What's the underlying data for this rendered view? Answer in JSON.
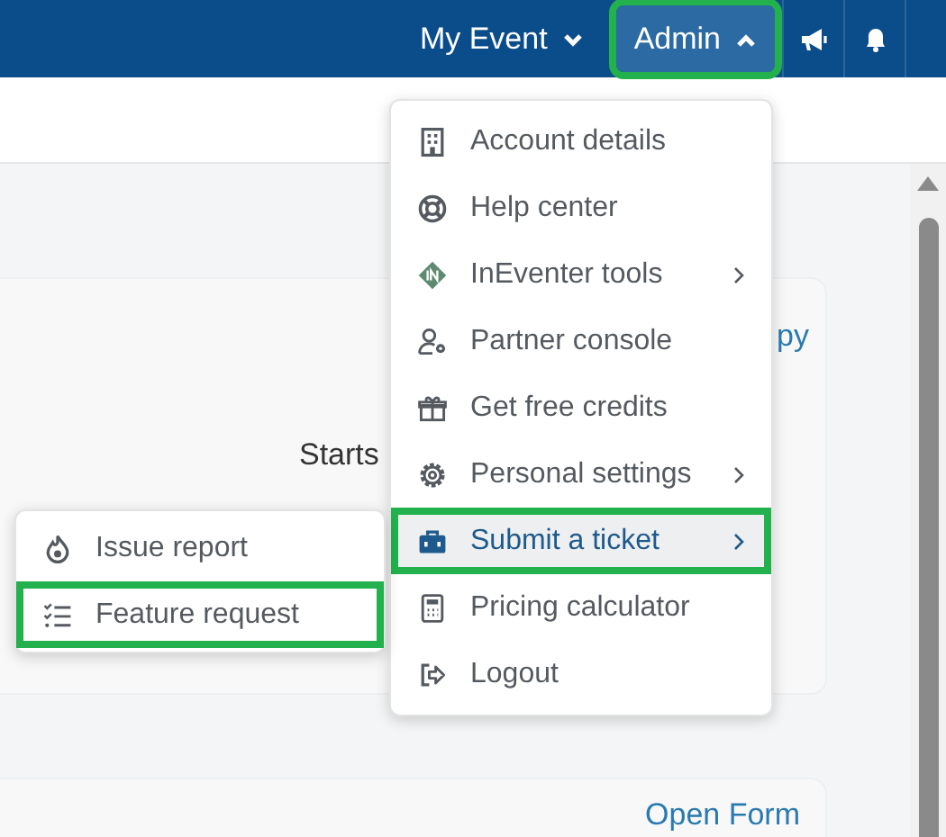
{
  "top_bar": {
    "event_menu": {
      "label": "My Event",
      "expanded": false
    },
    "admin_menu": {
      "label": "Admin",
      "expanded": true,
      "highlighted": true
    }
  },
  "background": {
    "card_1": {
      "link": "py",
      "label": "Starts"
    },
    "card_2": {
      "link": "Open Form"
    }
  },
  "admin_dropdown": {
    "items": [
      {
        "label": "Account details",
        "has_submenu": false,
        "selected": false,
        "highlighted": false
      },
      {
        "label": "Help center",
        "has_submenu": false,
        "selected": false,
        "highlighted": false
      },
      {
        "label": "InEventer tools",
        "has_submenu": true,
        "selected": false,
        "highlighted": false
      },
      {
        "label": "Partner console",
        "has_submenu": false,
        "selected": false,
        "highlighted": false
      },
      {
        "label": "Get free credits",
        "has_submenu": false,
        "selected": false,
        "highlighted": false
      },
      {
        "label": "Personal settings",
        "has_submenu": true,
        "selected": false,
        "highlighted": false
      },
      {
        "label": "Submit a ticket",
        "has_submenu": true,
        "selected": true,
        "highlighted": true
      },
      {
        "label": "Pricing calculator",
        "has_submenu": false,
        "selected": false,
        "highlighted": false
      },
      {
        "label": "Logout",
        "has_submenu": false,
        "selected": false,
        "highlighted": false
      }
    ]
  },
  "submenu": {
    "items": [
      {
        "label": "Issue report",
        "selected": false,
        "highlighted": false
      },
      {
        "label": "Feature request",
        "selected": false,
        "highlighted": true
      }
    ]
  }
}
